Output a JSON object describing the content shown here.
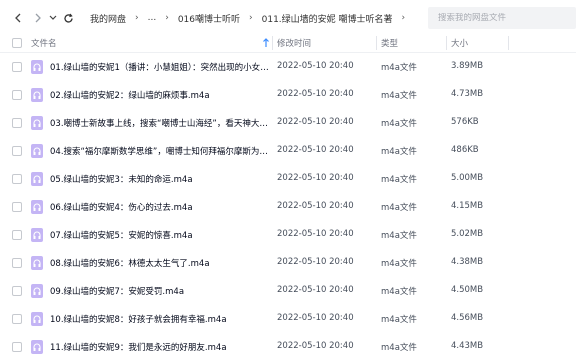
{
  "nav": {
    "breadcrumbs": [
      "我的网盘",
      "...",
      "016嘲博士听听",
      "011.绿山墙的安妮  嘲博士听名著"
    ],
    "search_placeholder": "搜索我的网盘文件"
  },
  "columns": {
    "name": "文件名",
    "modified": "修改时间",
    "type": "类型",
    "size": "大小"
  },
  "files": [
    {
      "name": "01.绿山墙的安妮1（播讲：小慧姐姐）：突然出现的小女孩.m4a",
      "modified": "2022-05-10 20:40",
      "type": "m4a文件",
      "size": "3.89MB"
    },
    {
      "name": "02.绿山墙的安妮2：绿山墙的麻烦事.m4a",
      "modified": "2022-05-10 20:40",
      "type": "m4a文件",
      "size": "4.73MB"
    },
    {
      "name": "03.嘲博士新故事上线，搜索“嘲博士山海经”，看天神大战.m4a",
      "modified": "2022-05-10 20:40",
      "type": "m4a文件",
      "size": "576KB"
    },
    {
      "name": "04.搜索“福尔摩斯数学思维”，嘲博士知何拜福尔摩斯为师.m4a",
      "modified": "2022-05-10 20:40",
      "type": "m4a文件",
      "size": "486KB"
    },
    {
      "name": "05.绿山墙的安妮3：未知的命运.m4a",
      "modified": "2022-05-10 20:40",
      "type": "m4a文件",
      "size": "5.00MB"
    },
    {
      "name": "06.绿山墙的安妮4：伤心的过去.m4a",
      "modified": "2022-05-10 20:40",
      "type": "m4a文件",
      "size": "4.15MB"
    },
    {
      "name": "07.绿山墙的安妮5：安妮的惊喜.m4a",
      "modified": "2022-05-10 20:40",
      "type": "m4a文件",
      "size": "5.02MB"
    },
    {
      "name": "08.绿山墙的安妮6：林德太太生气了.m4a",
      "modified": "2022-05-10 20:40",
      "type": "m4a文件",
      "size": "4.38MB"
    },
    {
      "name": "09.绿山墙的安妮7：安妮受罚.m4a",
      "modified": "2022-05-10 20:40",
      "type": "m4a文件",
      "size": "4.50MB"
    },
    {
      "name": "10.绿山墙的安妮8：好孩子就会拥有幸福.m4a",
      "modified": "2022-05-10 20:40",
      "type": "m4a文件",
      "size": "4.56MB"
    },
    {
      "name": "11.绿山墙的安妮9：我们是永远的好朋友.m4a",
      "modified": "2022-05-10 20:40",
      "type": "m4a文件",
      "size": "4.43MB"
    }
  ]
}
